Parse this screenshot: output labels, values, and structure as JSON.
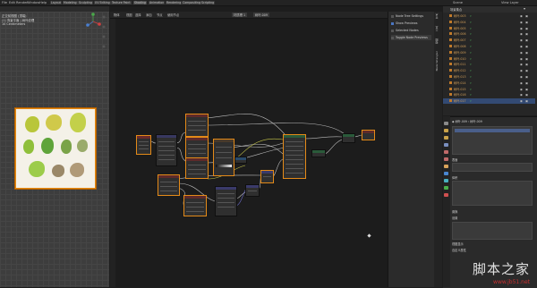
{
  "topbar": {
    "menus": [
      "File",
      "Edit",
      "Render",
      "Window",
      "Help"
    ],
    "workspaces": [
      "Layout",
      "Modeling",
      "Sculpting",
      "UV Editing",
      "Texture Paint",
      "Shading",
      "Animation",
      "Rendering",
      "Compositing",
      "Scripting"
    ],
    "scene_label": "Scene",
    "view_layer_label": "View Layer"
  },
  "viewport": {
    "overlay_lines": [
      "正交前视图 (顶端)",
      "(1) 背景平面 | 树叶纹理",
      "10 Centimeters"
    ]
  },
  "node_editor": {
    "header_items": [
      "物体",
      "视图",
      "选择",
      "添加",
      "节点",
      "使用节点"
    ],
    "slot_label": "材质槽 1",
    "material_name": "树叶.009"
  },
  "n_panel": {
    "rows": [
      {
        "label": "Node Tree Settings",
        "checked": false
      },
      {
        "label": "Show Previews",
        "checked": true
      },
      {
        "label": "Selected Nodes",
        "checked": false
      },
      {
        "label": "Toggle Node Previews",
        "checked": false
      }
    ],
    "tabs": [
      "节点",
      "工具",
      "视图",
      "Node Wrangler"
    ]
  },
  "outliner": {
    "header": "场景集合",
    "items": [
      "树叶.003",
      "树叶.004",
      "树叶.005",
      "树叶.006",
      "树叶.007",
      "树叶.008",
      "树叶.009",
      "树叶.010",
      "树叶.011",
      "树叶.012",
      "树叶.013",
      "树叶.014",
      "树叶.015",
      "树叶.016",
      "树叶.017"
    ]
  },
  "properties": {
    "section_title": "树叶.009",
    "rows": [
      "表面",
      "体积",
      "置换",
      "设置",
      "视图显示",
      "自定义属性"
    ]
  },
  "watermark": {
    "text": "脚本之家",
    "url": "www.jb51.net"
  }
}
